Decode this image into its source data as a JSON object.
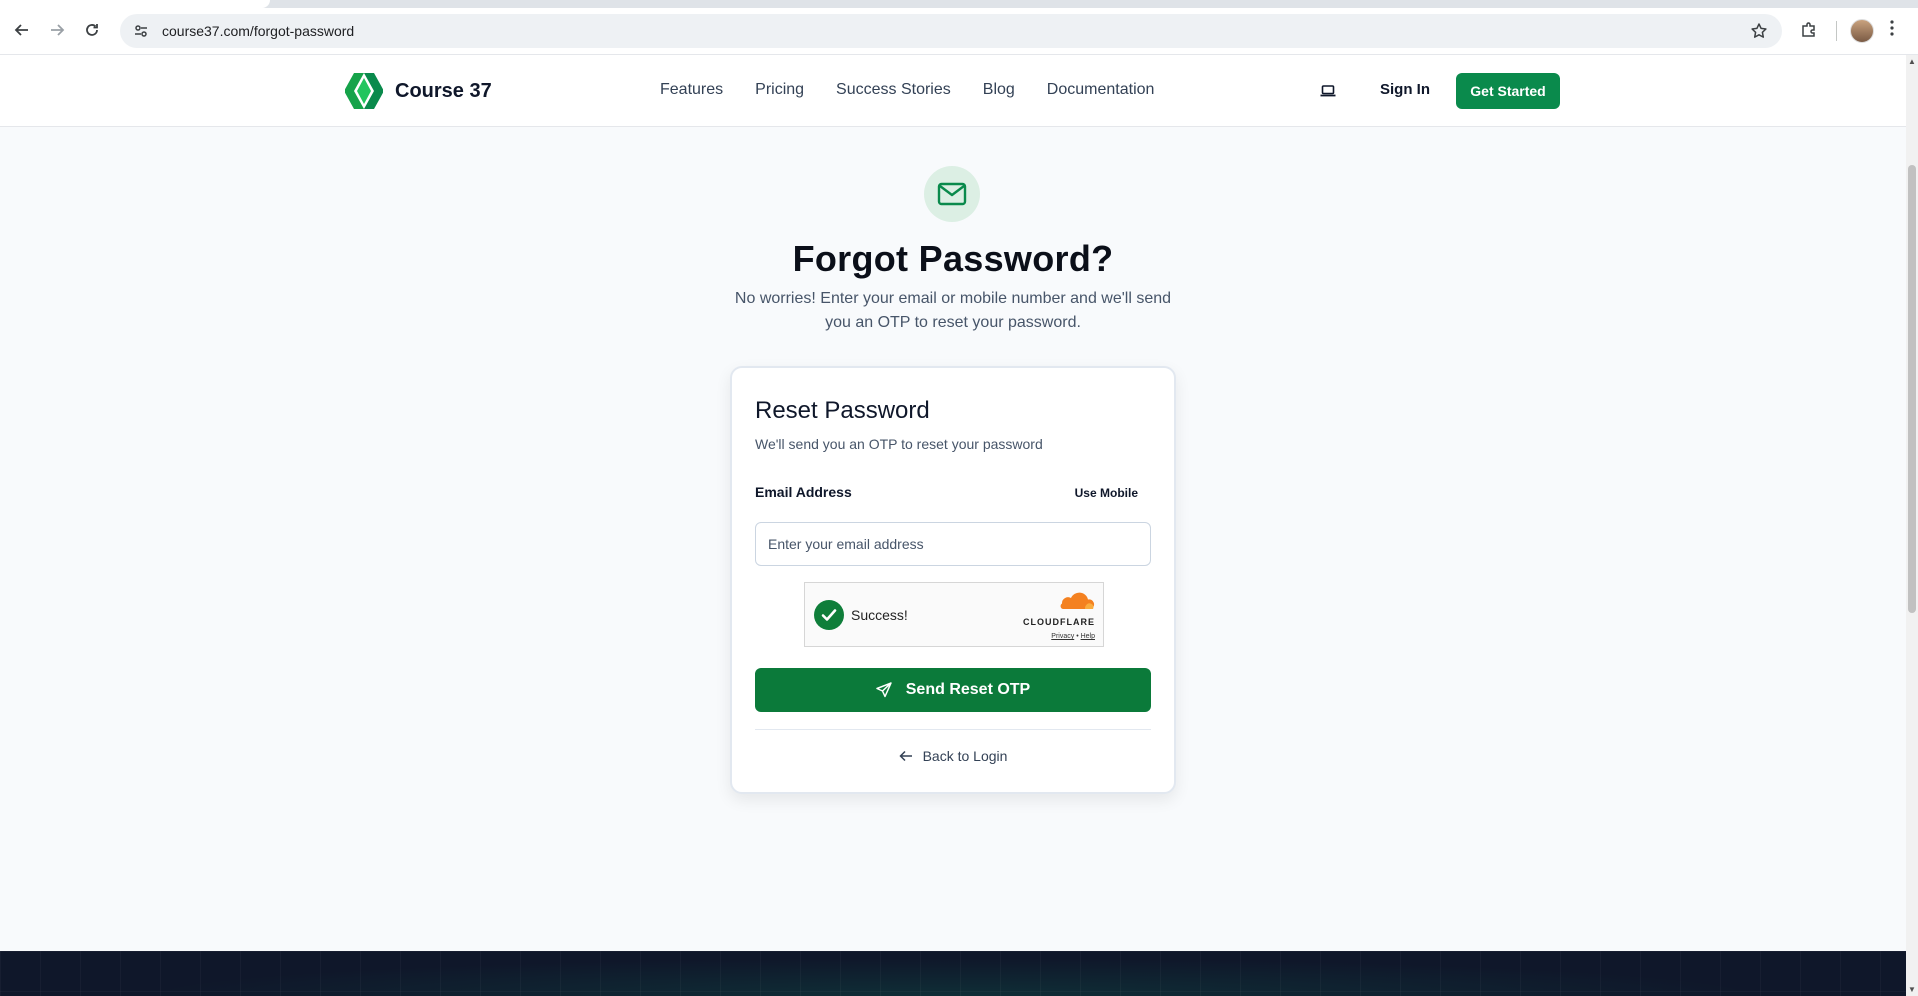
{
  "browser": {
    "url": "course37.com/forgot-password",
    "icons": {
      "back": "arrow-left-icon",
      "forward": "arrow-right-icon",
      "reload": "reload-icon",
      "site_info": "tune-icon",
      "bookmark": "star-icon",
      "extensions": "puzzle-icon",
      "profile": "avatar",
      "menu": "kebab-menu-icon"
    }
  },
  "header": {
    "brand_name": "Course 37",
    "nav": [
      "Features",
      "Pricing",
      "Success Stories",
      "Blog",
      "Documentation"
    ],
    "sign_in": "Sign In",
    "get_started": "Get Started",
    "theme_icon": "laptop-icon"
  },
  "hero": {
    "icon": "mail-icon",
    "title": "Forgot Password?",
    "subtitle": "No worries! Enter your email or mobile number and we'll send you an OTP to reset your password."
  },
  "card": {
    "title": "Reset Password",
    "subtitle": "We'll send you an OTP to reset your password",
    "email_label": "Email Address",
    "use_mobile": "Use Mobile",
    "email_placeholder": "Enter your email address",
    "email_value": "",
    "captcha": {
      "status": "Success!",
      "brand": "CLOUDFLARE",
      "privacy": "Privacy",
      "separator": "•",
      "help": "Help"
    },
    "send_button": "Send Reset OTP",
    "back_link": "Back to Login"
  },
  "colors": {
    "brand_green": "#0a8a4c",
    "button_green": "#0b7a3a",
    "footer_bg": "#0f172a",
    "page_bg": "#f8fafc"
  }
}
